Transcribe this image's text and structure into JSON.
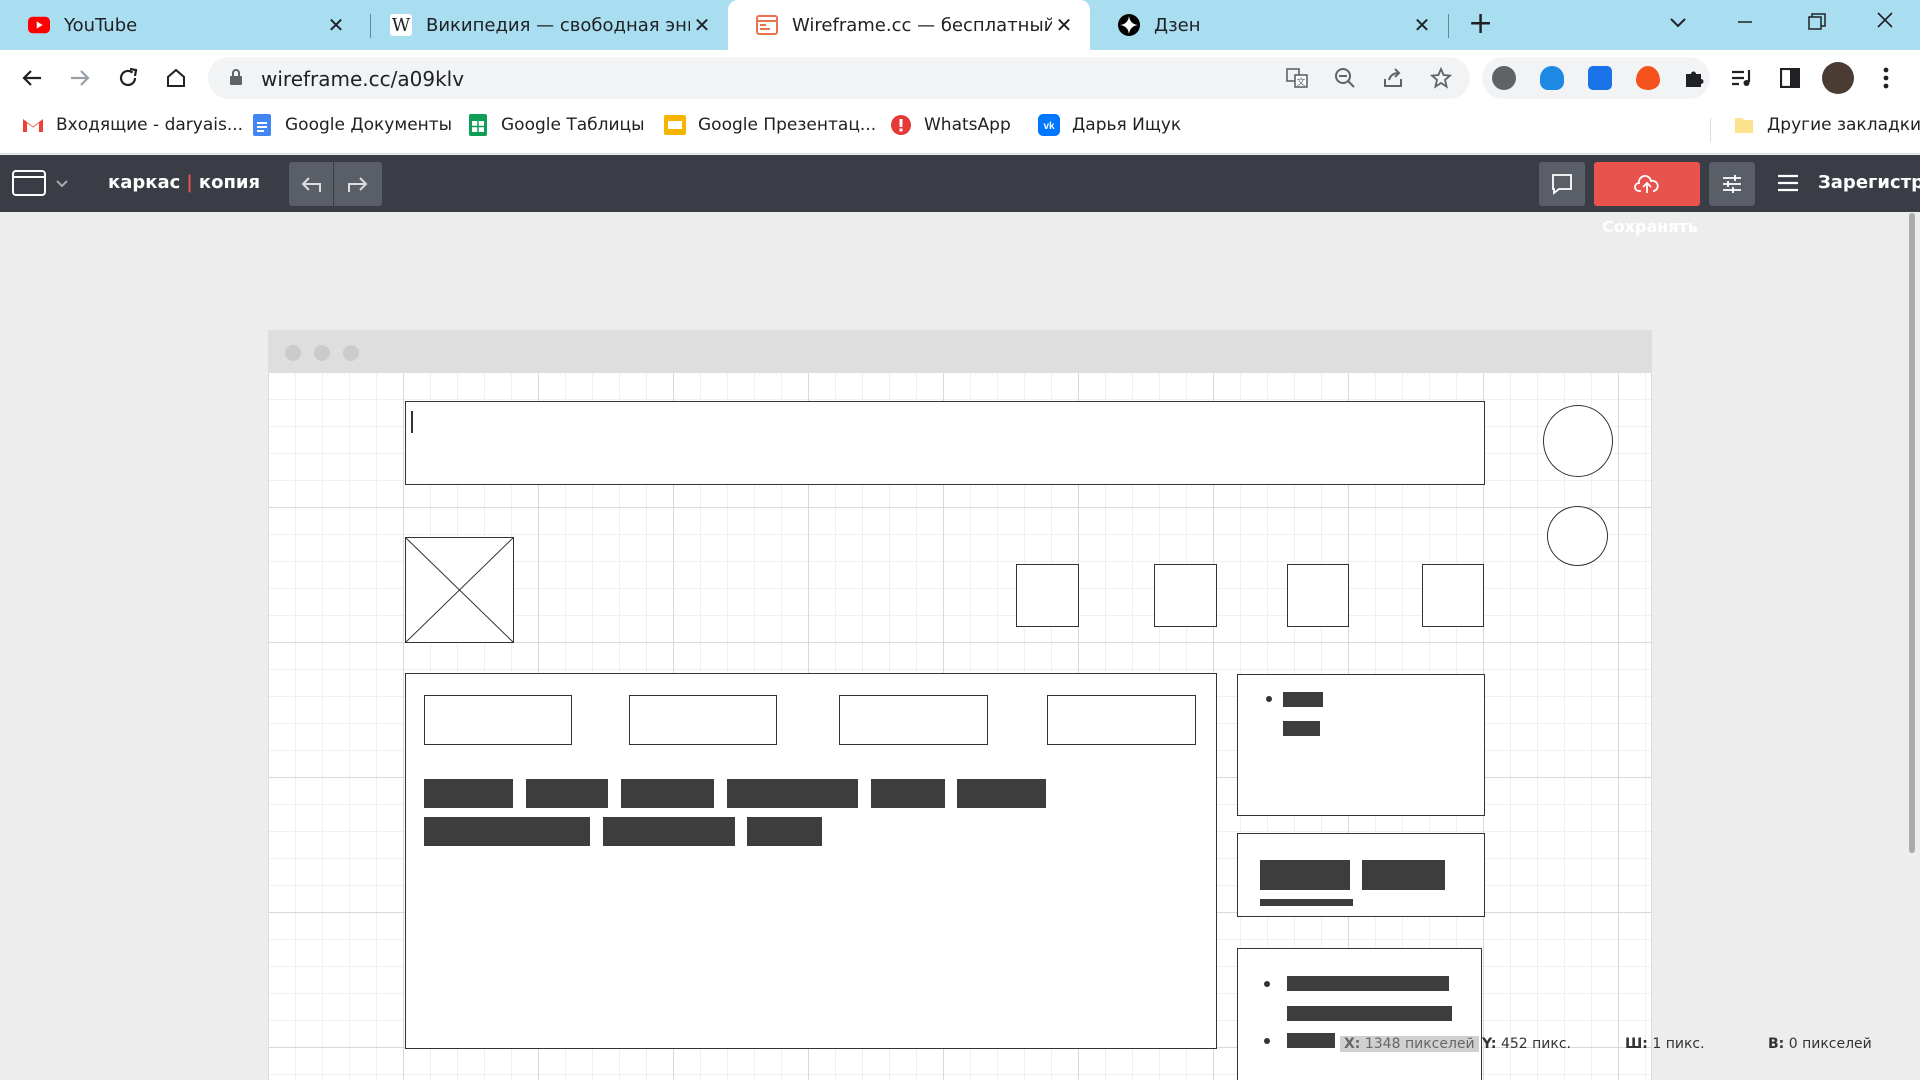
{
  "tabs": [
    {
      "title": "YouTube",
      "favicon": "youtube-icon"
    },
    {
      "title": "Википедия — свободная энцик",
      "favicon": "wikipedia-icon"
    },
    {
      "title": "Wireframe.cc — бесплатный он",
      "favicon": "wireframe-icon"
    },
    {
      "title": "Дзен",
      "favicon": "dzen-icon"
    }
  ],
  "active_tab": 2,
  "toolbar": {
    "url": "wireframe.cc/a09klv"
  },
  "bookmarks": [
    {
      "label": "Входящие - daryais...",
      "icon": "gmail-icon"
    },
    {
      "label": "Google Документы",
      "icon": "google-docs-icon"
    },
    {
      "label": "Google Таблицы",
      "icon": "google-sheets-icon"
    },
    {
      "label": "Google Презентац...",
      "icon": "google-slides-icon"
    },
    {
      "label": "WhatsApp",
      "icon": "whatsapp-icon"
    },
    {
      "label": "Дарья Ищук",
      "icon": "vk-icon"
    }
  ],
  "other_bookmarks": "Другие закладки",
  "app": {
    "title_left": "каркас",
    "title_sep": "|",
    "title_right": "копия",
    "save_tooltip": "Сохранять",
    "register": "Зарегистри",
    "colors": {
      "header": "#3a3d45",
      "save": "#e8534e",
      "accent": "#e8534e"
    }
  },
  "status": {
    "x_label": "X:",
    "x_value": "1348 пикселей",
    "y_label": "Y:",
    "y_value": "452 пикс.",
    "w_label": "Ш:",
    "w_value": "1 пикс.",
    "h_label": "В:",
    "h_value": "0 пикселей"
  }
}
